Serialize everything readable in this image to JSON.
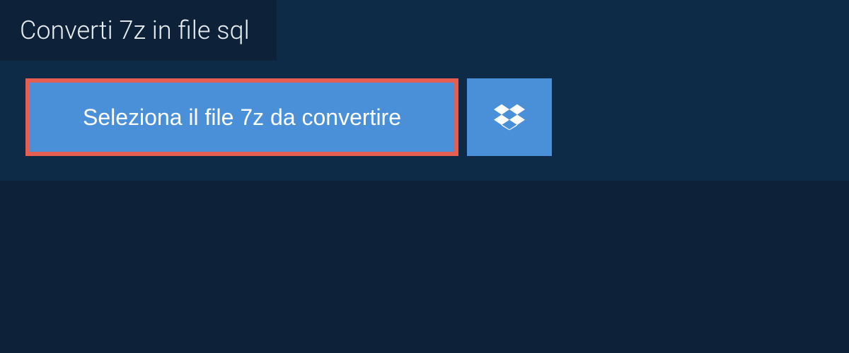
{
  "header": {
    "title": "Converti 7z in file sql"
  },
  "actions": {
    "select_file_label": "Seleziona il file 7z da convertire"
  }
}
